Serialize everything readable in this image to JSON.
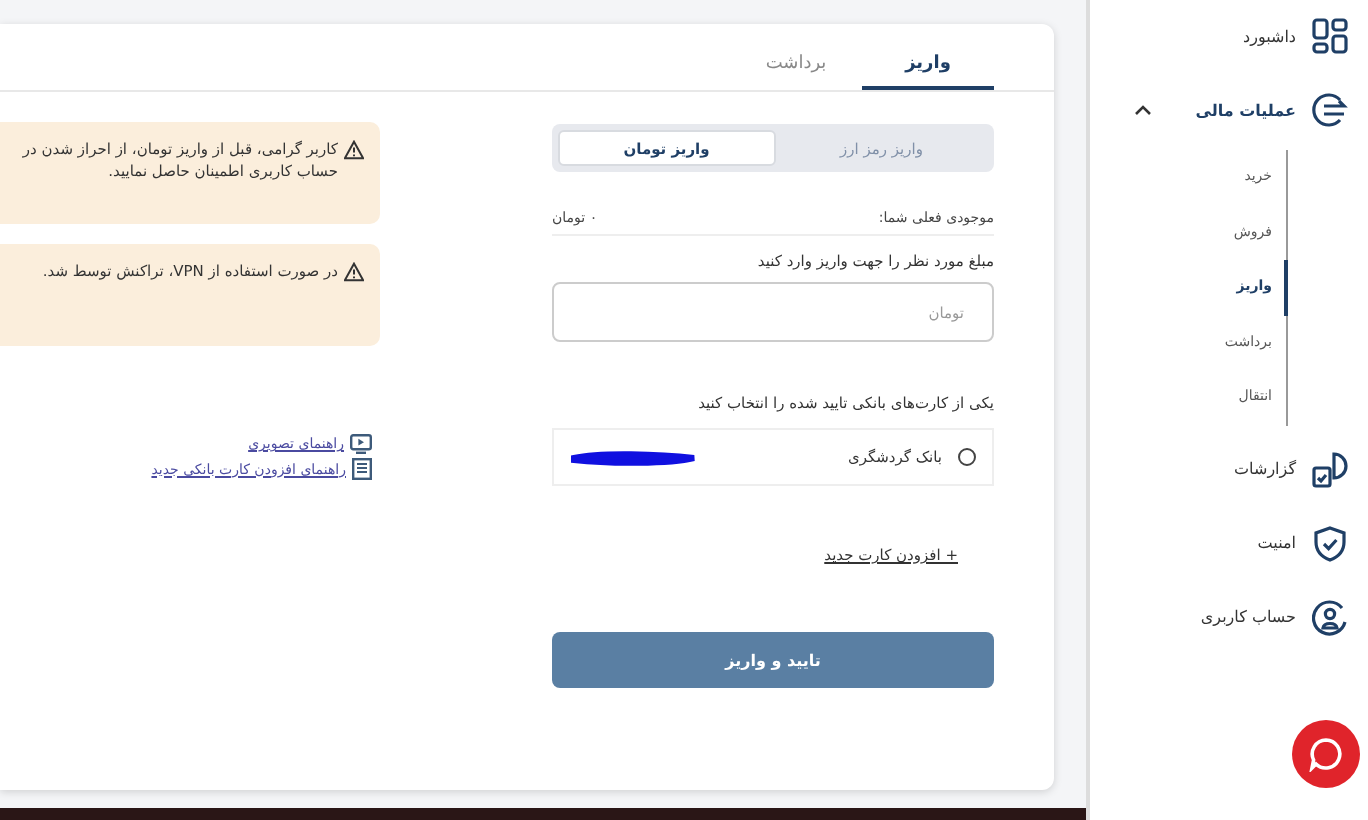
{
  "tabs": [
    {
      "label": "واریز",
      "selected": true
    },
    {
      "label": "برداشت",
      "selected": false
    }
  ],
  "alerts": [
    {
      "text": "کاربر گرامی، قبل از واریز تومان، از احراز شدن در حساب کاربری اطمینان حاصل نمایید."
    },
    {
      "text": "در صورت استفاده از VPN، تراکنش توسط شد."
    }
  ],
  "guide_links": [
    {
      "kind": "video",
      "label": "راهنمای تصویری"
    },
    {
      "kind": "document",
      "label": "راهنمای افزودن کارت بانکی جدید"
    }
  ],
  "deposit_types": [
    {
      "label": "واریز رمز ارز",
      "selected": false
    },
    {
      "label": "واریز تومان",
      "selected": true
    }
  ],
  "balance": {
    "label": "موجودی فعلی شما:",
    "value": "۰ تومان"
  },
  "amount": {
    "label": "مبلغ مورد نظر را جهت واریز وارد کنید",
    "placeholder": "تومان"
  },
  "cards": {
    "prompt": "یکی از کارت‌های بانکی تایید شده را انتخاب کنید",
    "items": [
      {
        "bank": "بانک گردشگری",
        "selected": false
      }
    ]
  },
  "add_card_link": "+ افزودن کارت جدید",
  "submit_button": "تایید و واریز",
  "sidebar": {
    "items": [
      {
        "kind": "dashboard",
        "label": "داشبورد"
      },
      {
        "kind": "finance",
        "label": "عملیات مالی",
        "expanded": true,
        "children": [
          {
            "label": "خرید",
            "selected": false
          },
          {
            "label": "فروش",
            "selected": false
          },
          {
            "label": "واریز",
            "selected": true
          },
          {
            "label": "برداشت",
            "selected": false
          },
          {
            "label": "انتقال",
            "selected": false
          }
        ]
      },
      {
        "kind": "reports",
        "label": "گزارشات"
      },
      {
        "kind": "security",
        "label": "امنیت"
      },
      {
        "kind": "account",
        "label": "حساب کاربری"
      }
    ]
  }
}
